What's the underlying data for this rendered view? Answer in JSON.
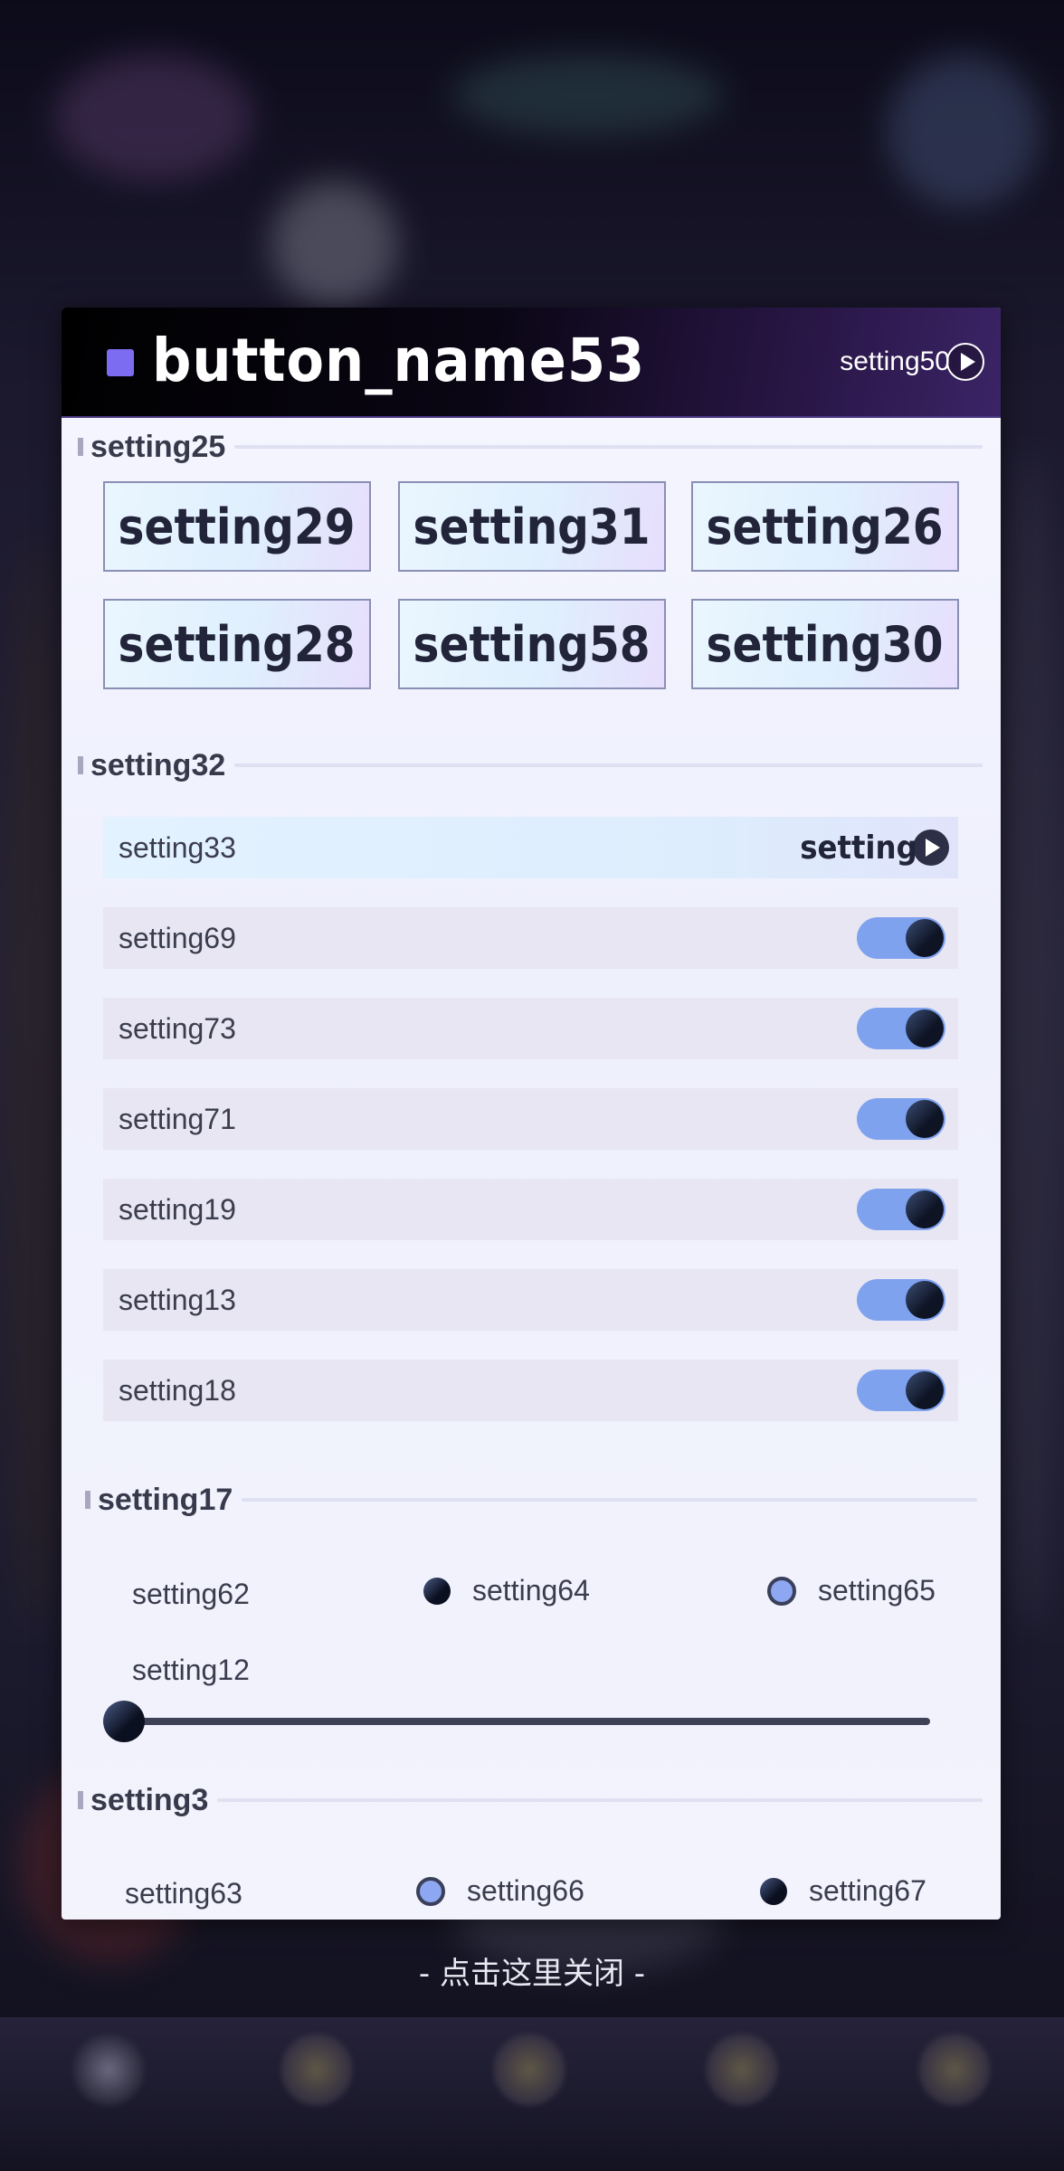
{
  "panel": {
    "title": "button_name53",
    "header_link_label": "setting50"
  },
  "sections": {
    "s25": {
      "label": "setting25"
    },
    "s32": {
      "label": "setting32"
    },
    "s17": {
      "label": "setting17"
    },
    "s3": {
      "label": "setting3"
    }
  },
  "grid_buttons": [
    "setting29",
    "setting31",
    "setting26",
    "setting28",
    "setting58",
    "setting30"
  ],
  "rows": {
    "link_row": {
      "label": "setting33",
      "link_label": "setting"
    },
    "toggles": [
      {
        "label": "setting69",
        "state": "on"
      },
      {
        "label": "setting73",
        "state": "on"
      },
      {
        "label": "setting71",
        "state": "on"
      },
      {
        "label": "setting19",
        "state": "on"
      },
      {
        "label": "setting13",
        "state": "on"
      },
      {
        "label": "setting18",
        "state": "on"
      }
    ]
  },
  "section17": {
    "radio_label": "setting62",
    "option_a": "setting64",
    "option_b": "setting65",
    "selected": "setting65",
    "slider_label": "setting12",
    "slider_value_fraction": 0.0
  },
  "section3": {
    "radio_label": "setting63",
    "option_a": "setting66",
    "option_b": "setting67",
    "selected": "setting66"
  },
  "close_hint": "- 点击这里关闭 -",
  "colors": {
    "accent": "#7b6cf2",
    "toggle_on": "#7fa2ef",
    "header_bg": "#000000"
  }
}
